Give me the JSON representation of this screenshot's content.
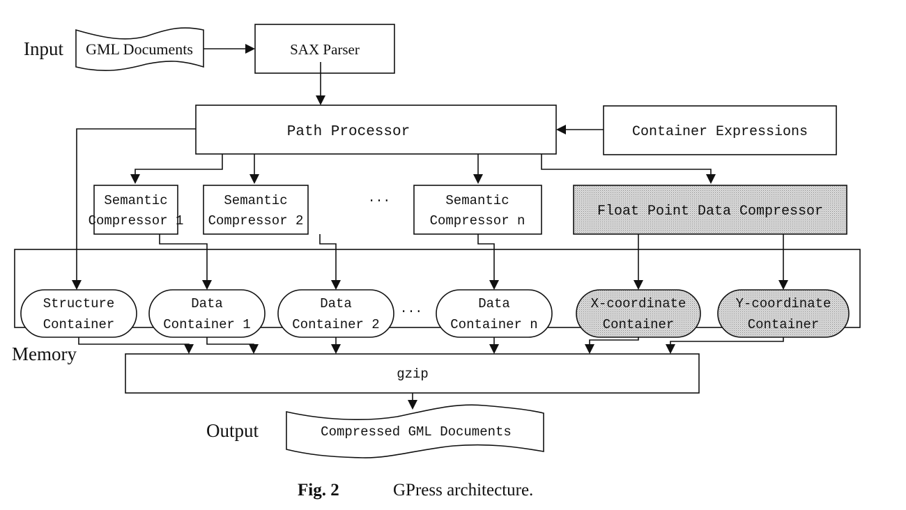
{
  "labels": {
    "input": "Input",
    "memory": "Memory",
    "output": "Output"
  },
  "nodes": {
    "gml_documents": "GML Documents",
    "sax_parser": "SAX Parser",
    "path_processor": "Path Processor",
    "container_expressions": "Container Expressions",
    "semantic_compressors": [
      {
        "line1": "Semantic",
        "line2": "Compressor 1"
      },
      {
        "line1": "Semantic",
        "line2": "Compressor 2"
      },
      {
        "line1": "Semantic",
        "line2": "Compressor n"
      }
    ],
    "float_point_compressor": "Float Point Data Compressor",
    "containers": [
      {
        "line1": "Structure",
        "line2": "Container"
      },
      {
        "line1": "Data",
        "line2": "Container 1"
      },
      {
        "line1": "Data",
        "line2": "Container 2"
      },
      {
        "line1": "Data",
        "line2": "Container n"
      },
      {
        "line1": "X-coordinate",
        "line2": "Container"
      },
      {
        "line1": "Y-coordinate",
        "line2": "Container"
      }
    ],
    "gzip": "gzip",
    "compressed_gml": "Compressed GML Documents",
    "ellipsis": "···"
  },
  "caption": {
    "fig_label": "Fig. 2",
    "text": "GPress architecture."
  },
  "colors": {
    "ink": "#111111",
    "shade": "#c8c8c8"
  }
}
